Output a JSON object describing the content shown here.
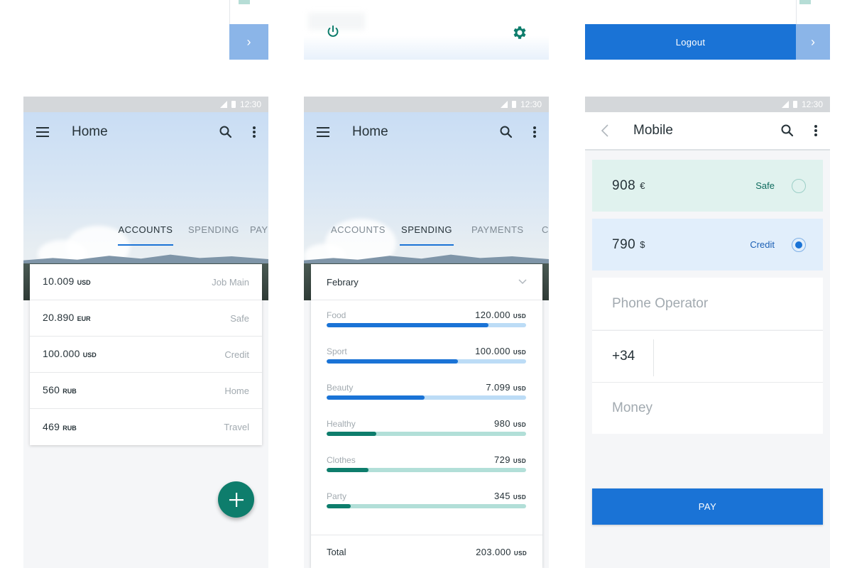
{
  "top_strip": {
    "logout_label": "Logout"
  },
  "status": {
    "time": "12:30"
  },
  "screen_home_accounts": {
    "title": "Home",
    "tabs": [
      "ACCOUNTS",
      "SPENDING",
      "PAY"
    ],
    "active_tab": "ACCOUNTS",
    "accounts": [
      {
        "amount": "10.009",
        "currency": "USD",
        "label": "Job Main"
      },
      {
        "amount": "20.890",
        "currency": "EUR",
        "label": "Safe"
      },
      {
        "amount": "100.000",
        "currency": "USD",
        "label": "Credit"
      },
      {
        "amount": "560",
        "currency": "RUB",
        "label": "Home"
      },
      {
        "amount": "469",
        "currency": "RUB",
        "label": "Travel"
      }
    ],
    "fab_icon": "plus-icon"
  },
  "screen_home_spending": {
    "title": "Home",
    "tabs": [
      "ACCOUNTS",
      "SPENDING",
      "PAYMENTS",
      "C"
    ],
    "active_tab": "SPENDING",
    "month": "Febrary",
    "categories": [
      {
        "name": "Food",
        "amount": "120.000",
        "currency": "USD",
        "fraction": 0.81,
        "fill_color": "#1a73d6",
        "track_color": "#bcdcf6"
      },
      {
        "name": "Sport",
        "amount": "100.000",
        "currency": "USD",
        "fraction": 0.66,
        "fill_color": "#1a73d6",
        "track_color": "#bcdcf6"
      },
      {
        "name": "Beauty",
        "amount": "7.099",
        "currency": "USD",
        "fraction": 0.49,
        "fill_color": "#1a73d6",
        "track_color": "#bcdcf6"
      },
      {
        "name": "Healthy",
        "amount": "980",
        "currency": "USD",
        "fraction": 0.25,
        "fill_color": "#0e7d6c",
        "track_color": "#b2dfd8"
      },
      {
        "name": "Clothes",
        "amount": "729",
        "currency": "USD",
        "fraction": 0.21,
        "fill_color": "#0e7d6c",
        "track_color": "#b2dfd8"
      },
      {
        "name": "Party",
        "amount": "345",
        "currency": "USD",
        "fraction": 0.12,
        "fill_color": "#0e7d6c",
        "track_color": "#b2dfd8"
      }
    ],
    "total_label": "Total",
    "total_amount": "203.000",
    "total_currency": "USD"
  },
  "screen_mobile": {
    "title": "Mobile",
    "options": [
      {
        "amount": "908",
        "currency": "€",
        "label": "Safe",
        "selected": false,
        "bg": "#e0f2ee",
        "label_color": "#0e6b5d"
      },
      {
        "amount": "790",
        "currency": "$",
        "label": "Credit",
        "selected": true,
        "bg": "#e1eefb",
        "label_color": "#1a5fb4"
      }
    ],
    "phone_operator_placeholder": "Phone Operator",
    "phone_prefix": "+34",
    "money_placeholder": "Money",
    "pay_label": "PAY"
  },
  "colors": {
    "primary_blue": "#1a73d6",
    "teal": "#0e7d6c",
    "arrow_light_blue": "#8bb5e8"
  }
}
